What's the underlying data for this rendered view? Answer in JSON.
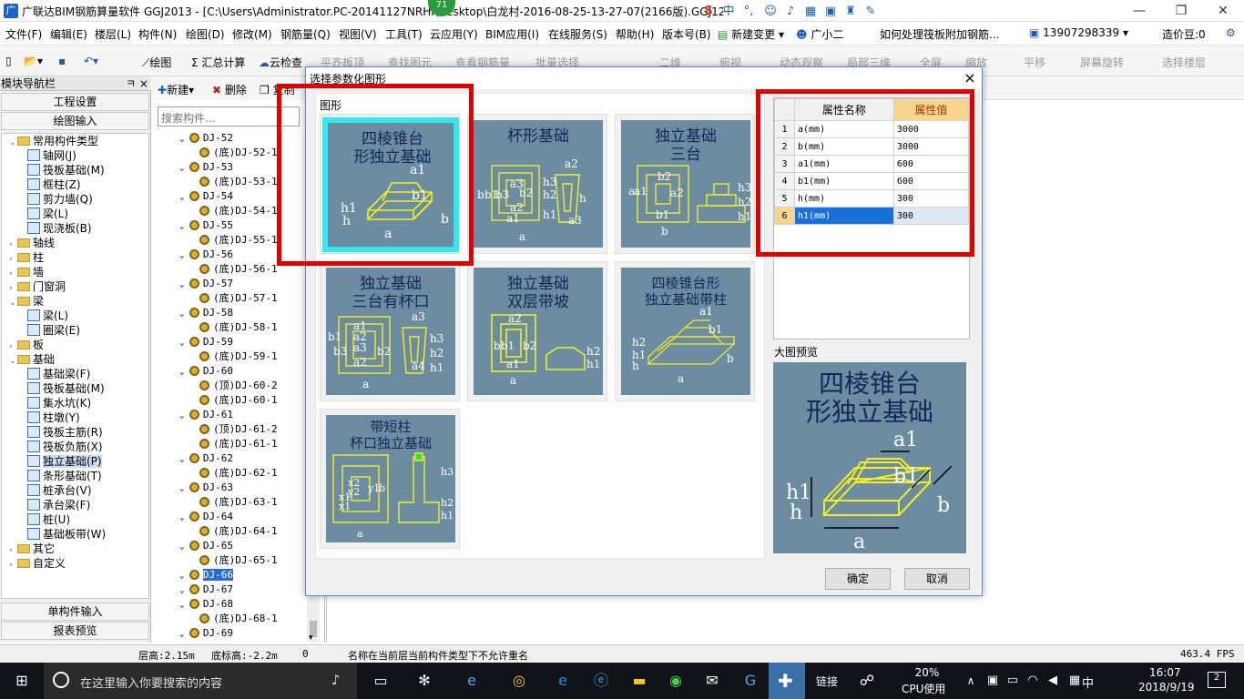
{
  "app": {
    "title": "广联达BIM钢筋算量软件 GGJ2013 - [C:\\Users\\Administrator.PC-20141127NRHI\\Desktop\\白龙村-2016-08-25-13-27-07(2166版).GGJ12]",
    "badge": "71",
    "ime_label": "中"
  },
  "menu": {
    "items": [
      "文件(F)",
      "编辑(E)",
      "楼层(L)",
      "构件(N)",
      "绘图(D)",
      "修改(M)",
      "钢筋量(Q)",
      "视图(V)",
      "工具(T)",
      "云应用(Y)",
      "BIM应用(I)",
      "在线服务(S)",
      "帮助(H)",
      "版本号(B)"
    ],
    "new_change": "新建变更",
    "assistant": "广小二",
    "ad_text": "如何处理筏板附加钢筋...",
    "phone": "13907298339",
    "price_bean": "造价豆:0"
  },
  "toolbar": {
    "items": [
      "绘图",
      "汇总计算",
      "云检查",
      "平齐板顶",
      "查找图元",
      "查看钢筋量",
      "批量选择",
      "二维",
      "俯视",
      "动态观察",
      "局部三维",
      "全屏",
      "缩放",
      "平移",
      "屏幕旋转",
      "选择楼层"
    ]
  },
  "leftnav": {
    "header": "模块导航栏",
    "pin": "ㅋ ×",
    "engineering_settings": "工程设置",
    "drawing_input": "绘图输入",
    "tree": [
      {
        "label": "常用构件类型",
        "level": 0,
        "type": "folder",
        "expanded": true
      },
      {
        "label": "轴网(J)",
        "level": 1,
        "type": "item"
      },
      {
        "label": "筏板基础(M)",
        "level": 1,
        "type": "item"
      },
      {
        "label": "框柱(Z)",
        "level": 1,
        "type": "item"
      },
      {
        "label": "剪力墙(Q)",
        "level": 1,
        "type": "item"
      },
      {
        "label": "梁(L)",
        "level": 1,
        "type": "item"
      },
      {
        "label": "现浇板(B)",
        "level": 1,
        "type": "item"
      },
      {
        "label": "轴线",
        "level": 0,
        "type": "folder",
        "expanded": false
      },
      {
        "label": "柱",
        "level": 0,
        "type": "folder",
        "expanded": false
      },
      {
        "label": "墙",
        "level": 0,
        "type": "folder",
        "expanded": false
      },
      {
        "label": "门窗洞",
        "level": 0,
        "type": "folder",
        "expanded": false
      },
      {
        "label": "梁",
        "level": 0,
        "type": "folder",
        "expanded": true
      },
      {
        "label": "梁(L)",
        "level": 1,
        "type": "item"
      },
      {
        "label": "圈梁(E)",
        "level": 1,
        "type": "item"
      },
      {
        "label": "板",
        "level": 0,
        "type": "folder",
        "expanded": false
      },
      {
        "label": "基础",
        "level": 0,
        "type": "folder",
        "expanded": true
      },
      {
        "label": "基础梁(F)",
        "level": 1,
        "type": "item"
      },
      {
        "label": "筏板基础(M)",
        "level": 1,
        "type": "item"
      },
      {
        "label": "集水坑(K)",
        "level": 1,
        "type": "item"
      },
      {
        "label": "柱墩(Y)",
        "level": 1,
        "type": "item"
      },
      {
        "label": "筏板主筋(R)",
        "level": 1,
        "type": "item"
      },
      {
        "label": "筏板负筋(X)",
        "level": 1,
        "type": "item"
      },
      {
        "label": "独立基础(P)",
        "level": 1,
        "type": "item",
        "selected": true
      },
      {
        "label": "条形基础(T)",
        "level": 1,
        "type": "item"
      },
      {
        "label": "桩承台(V)",
        "level": 1,
        "type": "item"
      },
      {
        "label": "承台梁(F)",
        "level": 1,
        "type": "item"
      },
      {
        "label": "桩(U)",
        "level": 1,
        "type": "item"
      },
      {
        "label": "基础板带(W)",
        "level": 1,
        "type": "item"
      },
      {
        "label": "其它",
        "level": 0,
        "type": "folder",
        "expanded": false
      },
      {
        "label": "自定义",
        "level": 0,
        "type": "folder",
        "expanded": false
      }
    ],
    "single_input": "单构件输入",
    "report_preview": "报表预览"
  },
  "midpanel": {
    "new": "新建",
    "delete": "删除",
    "copy": "复制",
    "search_placeholder": "搜索构件...",
    "components": [
      {
        "label": "DJ-52",
        "level": 0
      },
      {
        "label": "(底)DJ-52-1",
        "level": 1
      },
      {
        "label": "DJ-53",
        "level": 0
      },
      {
        "label": "(底)DJ-53-1",
        "level": 1
      },
      {
        "label": "DJ-54",
        "level": 0
      },
      {
        "label": "(底)DJ-54-1",
        "level": 1
      },
      {
        "label": "DJ-55",
        "level": 0
      },
      {
        "label": "(底)DJ-55-1",
        "level": 1
      },
      {
        "label": "DJ-56",
        "level": 0
      },
      {
        "label": "(底)DJ-56-1",
        "level": 1
      },
      {
        "label": "DJ-57",
        "level": 0
      },
      {
        "label": "(底)DJ-57-1",
        "level": 1
      },
      {
        "label": "DJ-58",
        "level": 0
      },
      {
        "label": "(底)DJ-58-1",
        "level": 1
      },
      {
        "label": "DJ-59",
        "level": 0
      },
      {
        "label": "(底)DJ-59-1",
        "level": 1
      },
      {
        "label": "DJ-60",
        "level": 0
      },
      {
        "label": "(顶)DJ-60-2",
        "level": 1
      },
      {
        "label": "(底)DJ-60-1",
        "level": 1
      },
      {
        "label": "DJ-61",
        "level": 0
      },
      {
        "label": "(顶)DJ-61-2",
        "level": 1
      },
      {
        "label": "(底)DJ-61-1",
        "level": 1
      },
      {
        "label": "DJ-62",
        "level": 0
      },
      {
        "label": "(底)DJ-62-1",
        "level": 1
      },
      {
        "label": "DJ-63",
        "level": 0
      },
      {
        "label": "(底)DJ-63-1",
        "level": 1
      },
      {
        "label": "DJ-64",
        "level": 0
      },
      {
        "label": "(底)DJ-64-1",
        "level": 1
      },
      {
        "label": "DJ-65",
        "level": 0
      },
      {
        "label": "(底)DJ-65-1",
        "level": 1
      },
      {
        "label": "DJ-66",
        "level": 0,
        "selected": true
      },
      {
        "label": "DJ-67",
        "level": 0
      },
      {
        "label": "DJ-68",
        "level": 0
      },
      {
        "label": "(底)DJ-68-1",
        "level": 1
      },
      {
        "label": "DJ-69",
        "level": 0
      }
    ]
  },
  "dialog": {
    "title": "选择参数化图形",
    "group_label": "图形",
    "shapes": [
      {
        "name": "四棱锥台形独立基础",
        "line1": "四棱锥台",
        "line2": "形独立基础",
        "selected": true,
        "dims": [
          "a1",
          "b1",
          "h1",
          "h",
          "a",
          "b"
        ]
      },
      {
        "name": "杯形基础",
        "line1": "杯形基础",
        "line2": "",
        "dims": [
          "a2",
          "a3",
          "b",
          "b1",
          "b3",
          "b2",
          "a3",
          "a2",
          "a1",
          "h3",
          "h2",
          "h1",
          "h",
          "a"
        ]
      },
      {
        "name": "独立基础三台",
        "line1": "独立基础",
        "line2": "三台",
        "dims": [
          "a",
          "b2",
          "b1",
          "a2",
          "a1",
          "b",
          "h3",
          "h2",
          "h1"
        ]
      },
      {
        "name": "独立基础三台有杯口",
        "line1": "独立基础",
        "line2": "三台有杯口",
        "dims": [
          "a1",
          "a2",
          "a3",
          "b1",
          "b2",
          "b3",
          "h3",
          "h2",
          "h1",
          "a4",
          "a"
        ]
      },
      {
        "name": "独立基础双层带坡",
        "line1": "独立基础",
        "line2": "双层带坡",
        "dims": [
          "a2",
          "b2",
          "b1",
          "a1",
          "a",
          "b",
          "h2",
          "h1"
        ]
      },
      {
        "name": "四棱锥台形独立基础带柱",
        "line1": "四棱锥台形",
        "line2": "独立基础带柱",
        "dims": [
          "a1",
          "b1",
          "h2",
          "h1",
          "h",
          "a",
          "b"
        ]
      },
      {
        "name": "带短柱杯口独立基础",
        "line1": "带短柱",
        "line2": "杯口独立基础",
        "dims": [
          "x1",
          "y1",
          "x2",
          "y2",
          "b",
          "h3",
          "h2",
          "h1",
          "a"
        ]
      }
    ],
    "properties": {
      "headers": [
        "属性名称",
        "属性值"
      ],
      "rows": [
        {
          "no": "1",
          "name": "a(mm)",
          "value": "3000"
        },
        {
          "no": "2",
          "name": "b(mm)",
          "value": "3000"
        },
        {
          "no": "3",
          "name": "a1(mm)",
          "value": "600"
        },
        {
          "no": "4",
          "name": "b1(mm)",
          "value": "600"
        },
        {
          "no": "5",
          "name": "h(mm)",
          "value": "300"
        },
        {
          "no": "6",
          "name": "h1(mm)",
          "value": "300",
          "current": true
        }
      ]
    },
    "preview_label": "大图预览",
    "preview": {
      "line1": "四棱锥台",
      "line2": "形独立基础"
    },
    "ok": "确定",
    "cancel": "取消",
    "close": "×"
  },
  "statusbar": {
    "floor_height": "层高:2.15m",
    "bottom_elevation": "底标高:-2.2m",
    "zero": "0",
    "message": "名称在当前层当前构件类型下不允许重名",
    "fps": "463.4 FPS"
  },
  "taskbar": {
    "search_placeholder": "在这里输入你要搜索的内容",
    "link": "链接",
    "cpu_percent": "20%",
    "cpu_label": "CPU使用",
    "ime": "中",
    "time": "16:07",
    "date": "2018/9/19",
    "notif": "2"
  },
  "colors": {
    "highlight_red": "#e00000",
    "thumb_bg": "#6c8ca2",
    "selected_cyan": "#33e8ec",
    "selection_blue": "#1a6fd8",
    "header_value_bg": "#f6d58e"
  }
}
